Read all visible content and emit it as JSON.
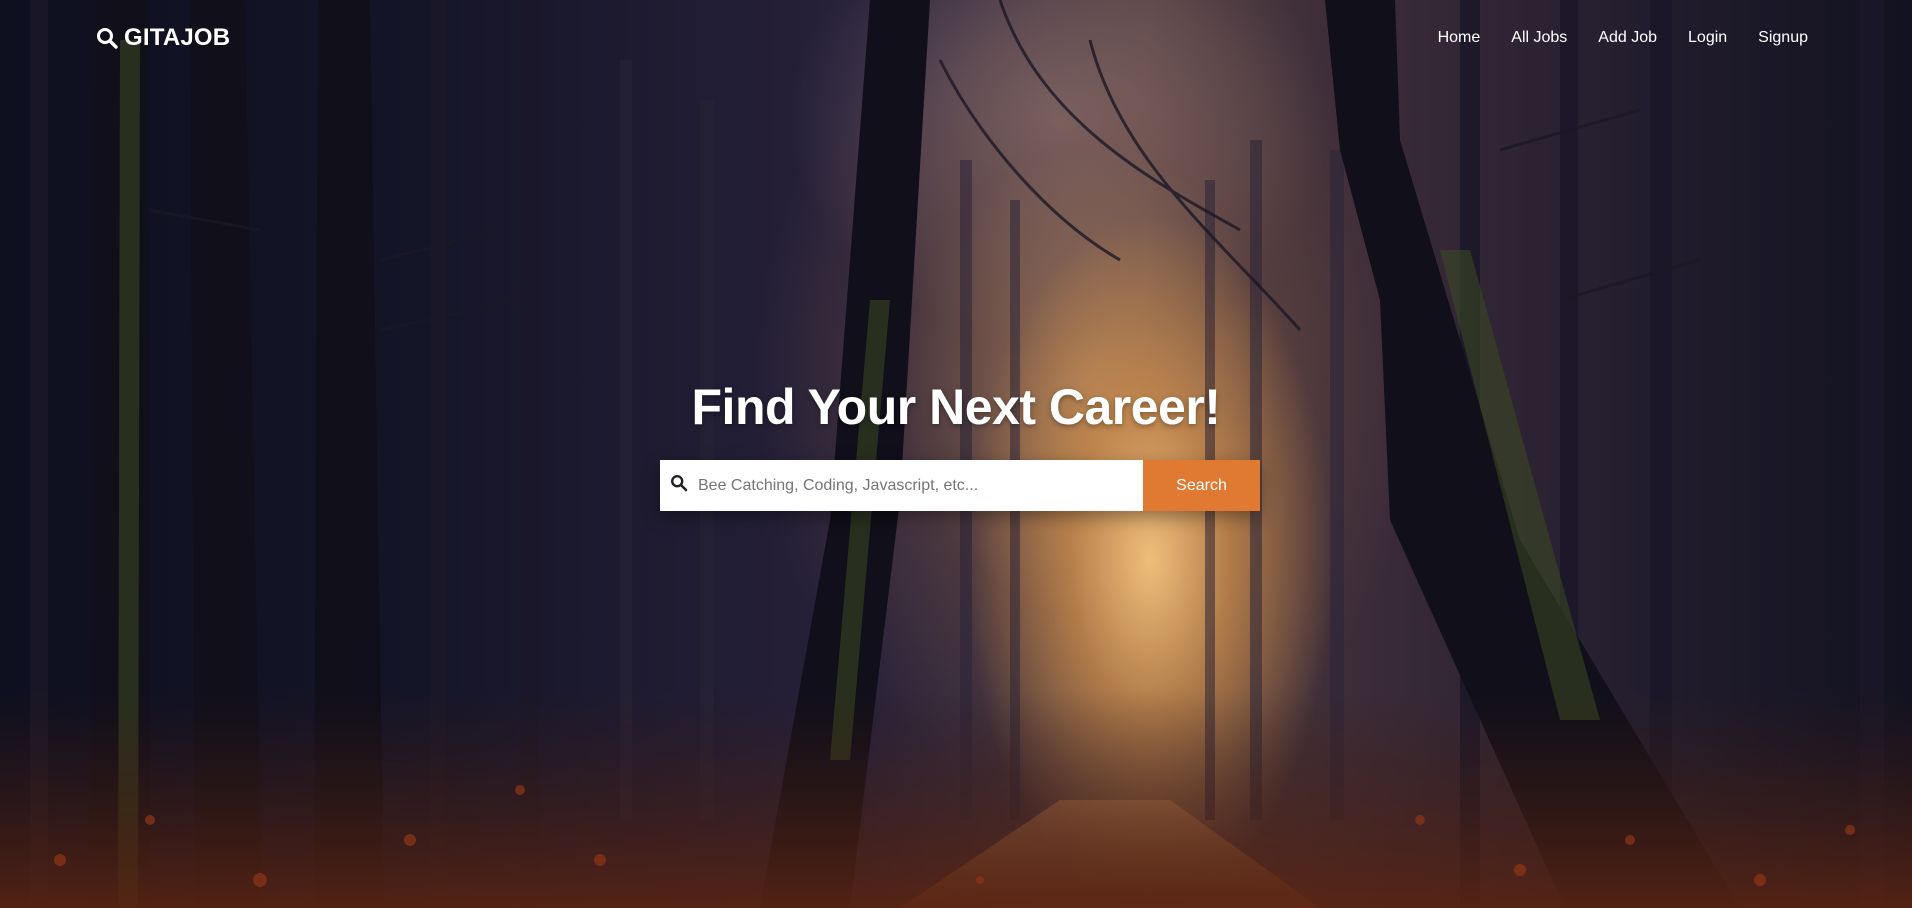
{
  "brand": {
    "name": "GITAJOB",
    "icon": "search-icon"
  },
  "nav": {
    "items": [
      "Home",
      "All Jobs",
      "Add Job",
      "Login",
      "Signup"
    ]
  },
  "hero": {
    "headline": "Find Your Next Career!",
    "search": {
      "icon": "search-icon",
      "placeholder": "Bee Catching, Coding, Javascript, etc...",
      "value": "",
      "button_label": "Search"
    }
  },
  "colors": {
    "accent": "#e07a32",
    "text": "#ffffff",
    "input_bg": "#ffffff"
  }
}
